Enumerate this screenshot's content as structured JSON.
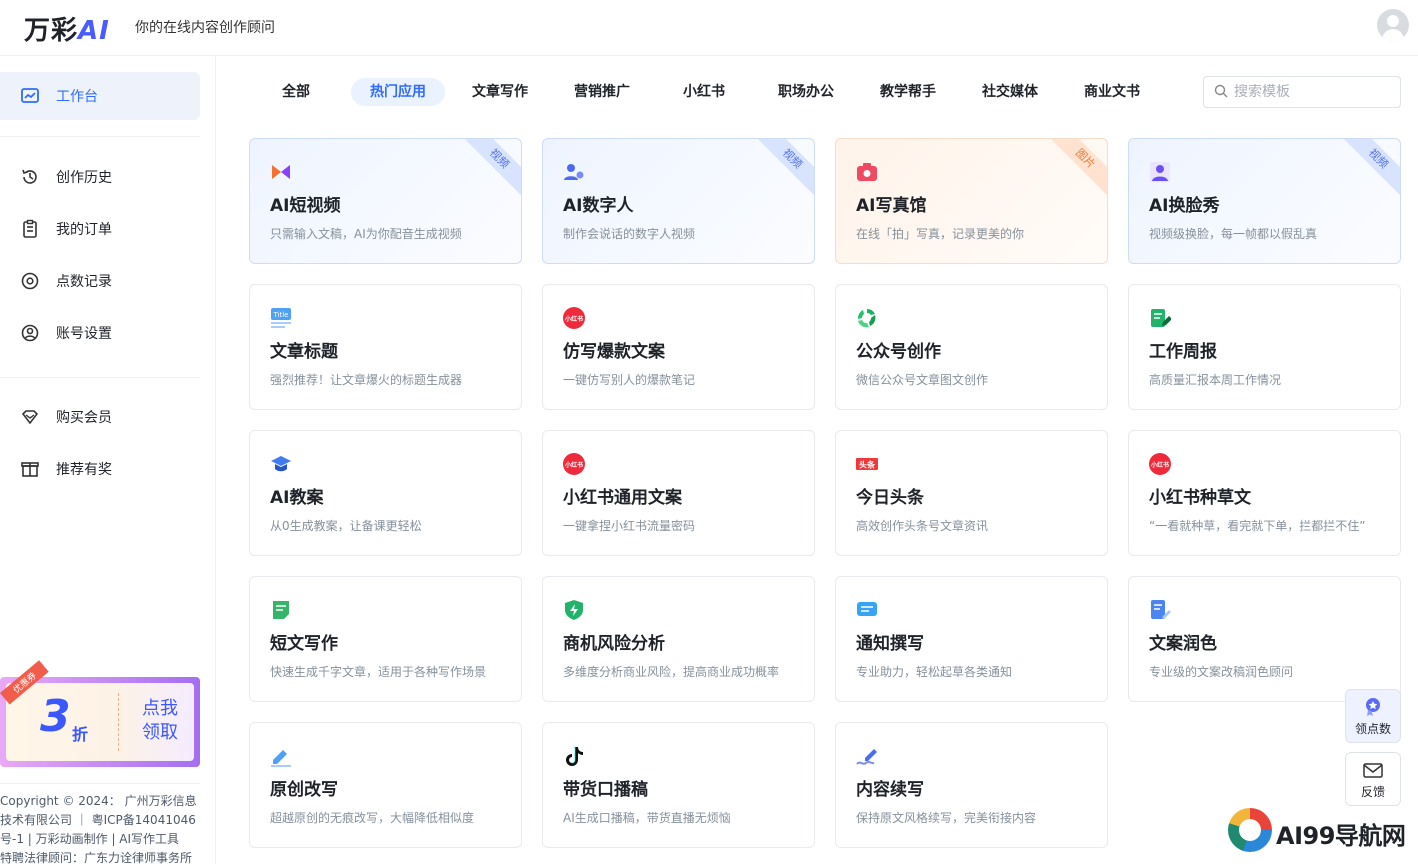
{
  "header": {
    "logo_text": "万彩",
    "logo_ai": "AI",
    "tagline": "你的在线内容创作顾问"
  },
  "sidebar": {
    "items": [
      {
        "label": "工作台",
        "icon": "dashboard-icon"
      },
      {
        "label": "创作历史",
        "icon": "history-icon"
      },
      {
        "label": "我的订单",
        "icon": "order-icon"
      },
      {
        "label": "点数记录",
        "icon": "points-icon"
      },
      {
        "label": "账号设置",
        "icon": "account-icon"
      },
      {
        "label": "购买会员",
        "icon": "diamond-icon"
      },
      {
        "label": "推荐有奖",
        "icon": "gift-icon"
      }
    ],
    "promo": {
      "ribbon": "优惠券",
      "big": "3",
      "small": "折",
      "cta_line1": "点我",
      "cta_line2": "领取"
    },
    "copyright_lines": [
      "Copyright © 2024： 广州万彩信息",
      "技术有限公司 ｜ 粤ICP备14041046",
      "号-1 | 万彩动画制作 | AI写作工具",
      "特聘法律顾问：广东力诠律师事务所"
    ]
  },
  "tabs": [
    "全部",
    "热门应用",
    "文章写作",
    "营销推广",
    "小红书",
    "职场办公",
    "教学帮手",
    "社交媒体",
    "商业文书"
  ],
  "active_tab": "热门应用",
  "search": {
    "placeholder": "搜索模板",
    "value": ""
  },
  "cards": [
    {
      "title": "AI短视频",
      "desc": "只需输入文稿，AI为你配音生成视频",
      "badge": "视频",
      "icon": "video-bowtie-icon"
    },
    {
      "title": "AI数字人",
      "desc": "制作会说话的数字人视频",
      "badge": "视频",
      "icon": "digital-human-icon"
    },
    {
      "title": "AI写真馆",
      "desc": "在线「拍」写真，记录更美的你",
      "badge": "图片",
      "icon": "camera-icon"
    },
    {
      "title": "AI换脸秀",
      "desc": "视频级换脸，每一帧都以假乱真",
      "badge": "视频",
      "icon": "face-swap-icon"
    },
    {
      "title": "文章标题",
      "desc": "强烈推荐！让文章爆火的标题生成器",
      "badge": "",
      "icon": "title-icon"
    },
    {
      "title": "仿写爆款文案",
      "desc": "一键仿写别人的爆款笔记",
      "badge": "",
      "icon": "xiaohongshu-icon"
    },
    {
      "title": "公众号创作",
      "desc": "微信公众号文章图文创作",
      "badge": "",
      "icon": "wechat-official-icon"
    },
    {
      "title": "工作周报",
      "desc": "高质量汇报本周工作情况",
      "badge": "",
      "icon": "report-edit-icon"
    },
    {
      "title": "AI教案",
      "desc": "从0生成教案，让备课更轻松",
      "badge": "",
      "icon": "graduation-cap-icon"
    },
    {
      "title": "小红书通用文案",
      "desc": "一键拿捏小红书流量密码",
      "badge": "",
      "icon": "xiaohongshu-icon"
    },
    {
      "title": "今日头条",
      "desc": "高效创作头条号文章资讯",
      "badge": "",
      "icon": "toutiao-icon"
    },
    {
      "title": "小红书种草文",
      "desc": "“一看就种草，看完就下单，拦都拦不住”",
      "badge": "",
      "icon": "xiaohongshu-icon"
    },
    {
      "title": "短文写作",
      "desc": "快速生成千字文章，适用于各种写作场景",
      "badge": "",
      "icon": "short-doc-icon"
    },
    {
      "title": "商机风险分析",
      "desc": "多维度分析商业风险，提高商业成功概率",
      "badge": "",
      "icon": "shield-bolt-icon"
    },
    {
      "title": "通知撰写",
      "desc": "专业助力，轻松起草各类通知",
      "badge": "",
      "icon": "message-icon"
    },
    {
      "title": "文案润色",
      "desc": "专业级的文案改稿润色顾问",
      "badge": "",
      "icon": "doc-polish-icon"
    },
    {
      "title": "原创改写",
      "desc": "超越原创的无痕改写，大幅降低相似度",
      "badge": "",
      "icon": "pen-rewrite-icon"
    },
    {
      "title": "带货口播稿",
      "desc": "AI生成口播稿，带货直播无烦恼",
      "badge": "",
      "icon": "tiktok-icon"
    },
    {
      "title": "内容续写",
      "desc": "保持原文风格续写，完美衔接内容",
      "badge": "",
      "icon": "continue-write-icon"
    }
  ],
  "xhs_logo_text": "小红书",
  "toutiao_logo_text": "头条",
  "title_logo_text": "Title",
  "float": {
    "points_label": "领点数",
    "feedback_label": "反馈"
  },
  "watermark": {
    "text": "AI99导航网"
  },
  "colors": {
    "accent": "#2f6bff",
    "video_badge": "#4b6cf0",
    "photo_badge": "#ec7b3a"
  }
}
